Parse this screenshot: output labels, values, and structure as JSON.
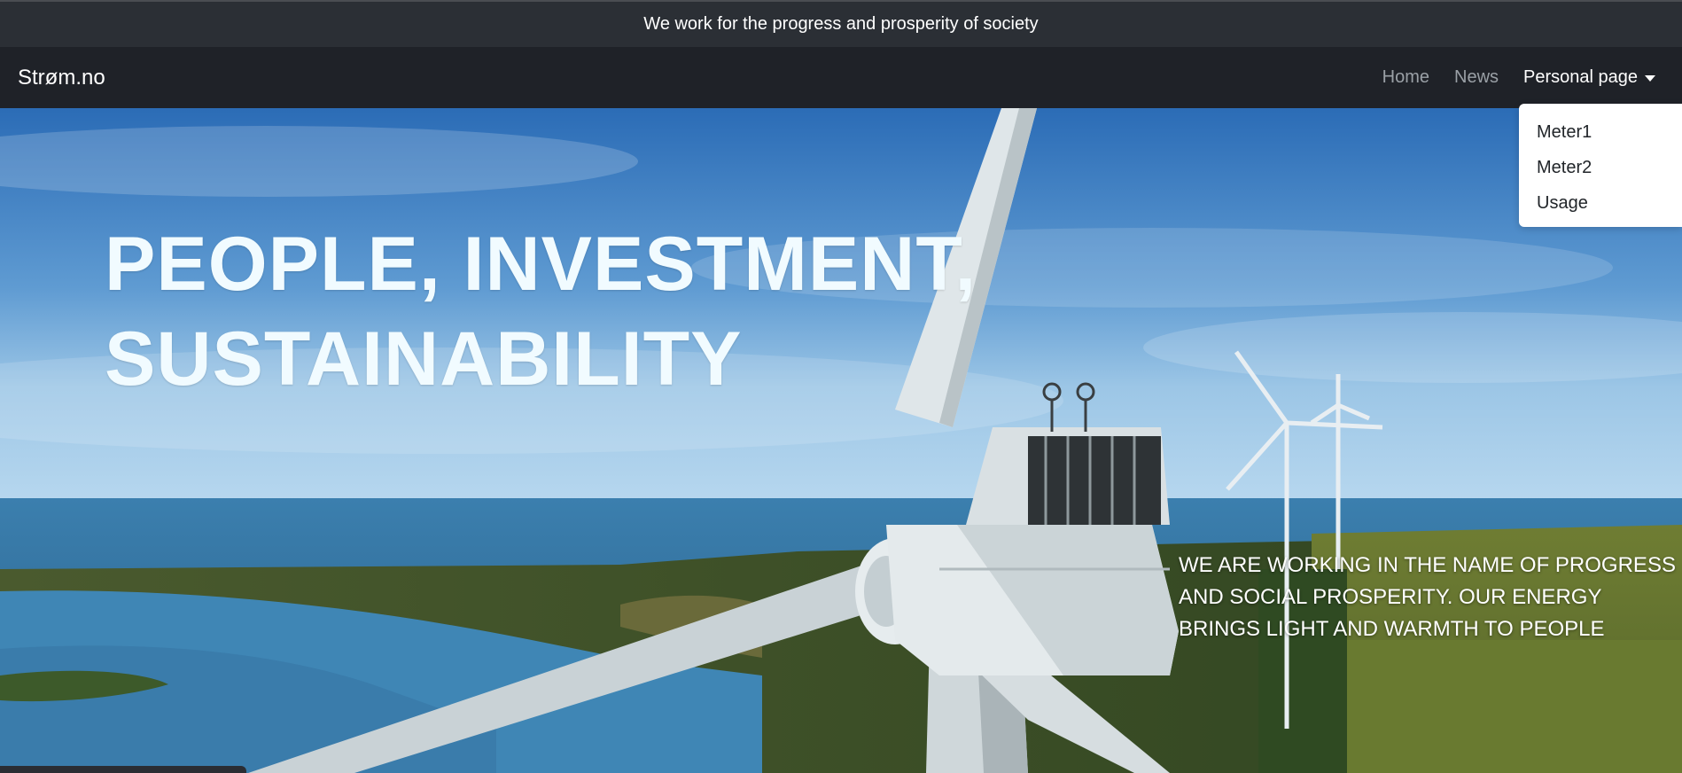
{
  "announcement": "We work for the progress and prosperity of society",
  "brand": "Strøm.no",
  "nav": {
    "home": "Home",
    "news": "News",
    "personal": "Personal page"
  },
  "dropdown": {
    "items": [
      "Meter1",
      "Meter2",
      "Usage"
    ]
  },
  "hero": {
    "headline_line1": "PEOPLE, INVESTMENT,",
    "headline_line2": "SUSTAINABILITY",
    "sub_line1": "WE ARE WORKING IN THE NAME OF PROGRESS",
    "sub_line2": "AND SOCIAL PROSPERITY. OUR ENERGY",
    "sub_line3": "BRINGS LIGHT AND WARMTH TO PEOPLE"
  },
  "colors": {
    "topbar": "#2b2f35",
    "navbar": "#1f2228",
    "headline": "#f1fbff",
    "sky_top": "#2e6fb8",
    "sea": "#2f6f9c"
  }
}
